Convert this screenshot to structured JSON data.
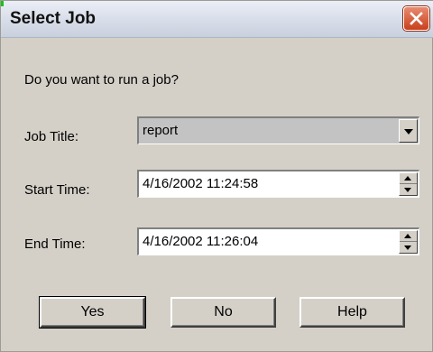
{
  "window": {
    "title": "Select Job"
  },
  "prompt": "Do you want to run a job?",
  "job_title": {
    "label": "Job Title:",
    "value": "report"
  },
  "start_time": {
    "label": "Start Time:",
    "value": "4/16/2002 11:24:58"
  },
  "end_time": {
    "label": "End Time:",
    "value": "4/16/2002 11:26:04"
  },
  "buttons": {
    "yes": "Yes",
    "no": "No",
    "help": "Help"
  },
  "colors": {
    "dialog_bg": "#d4d0c8",
    "close_red": "#c8401e",
    "combo_bg": "#c3c3c3"
  },
  "icons": {
    "close": "close-icon",
    "dropdown": "chevron-down-icon",
    "spin_up": "spin-up-icon",
    "spin_down": "spin-down-icon"
  }
}
